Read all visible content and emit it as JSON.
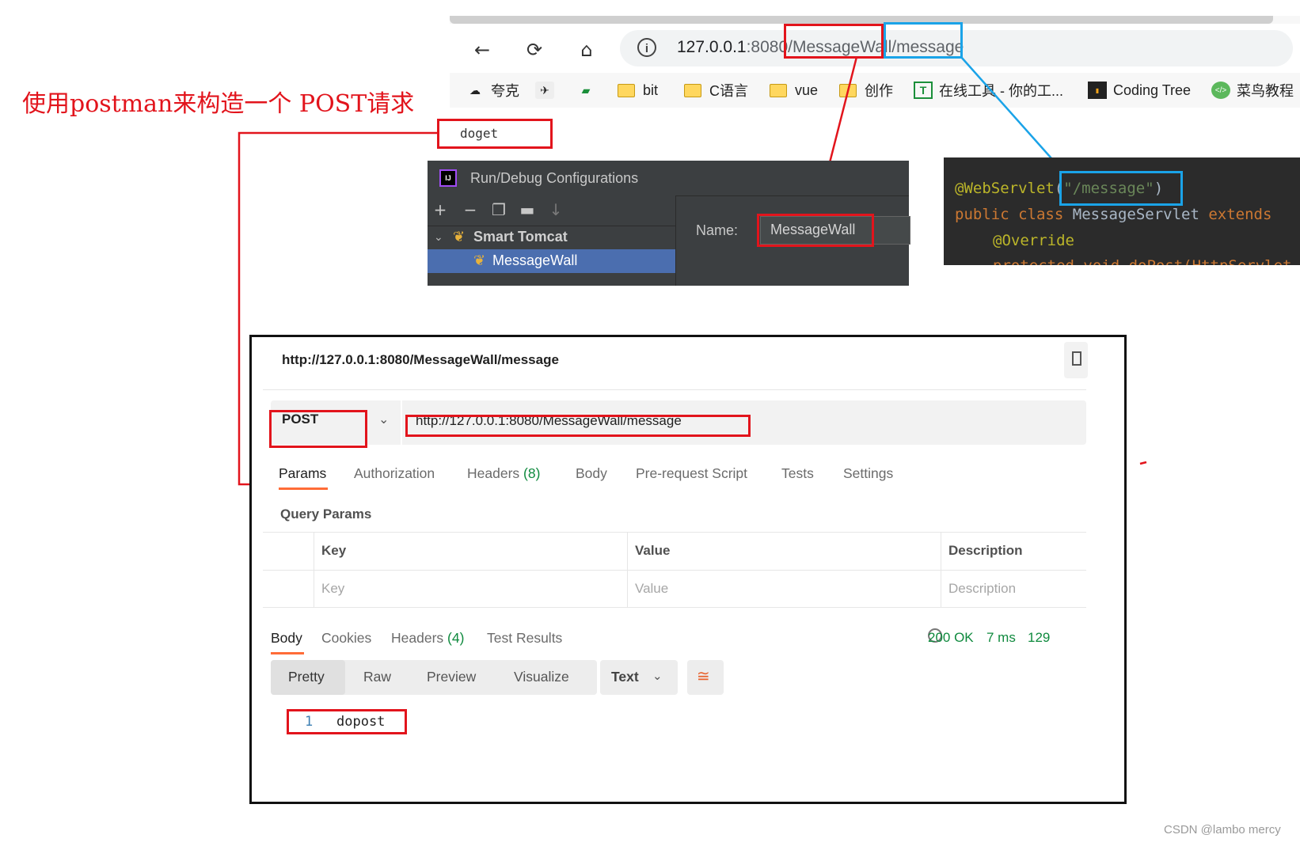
{
  "annotation": {
    "title": "使用postman来构造一个 POST请求",
    "doget_label": "doget"
  },
  "browser": {
    "url_host": "127.0.0.1",
    "url_port": ":8080",
    "url_path_context": "/MessageWall",
    "url_path_servlet": "/message",
    "bookmarks": [
      {
        "label": "夸克",
        "icon": "quark-icon"
      },
      {
        "label": "",
        "icon": "plugin-icon"
      },
      {
        "label": "",
        "icon": "map-icon"
      },
      {
        "label": "bit",
        "icon": "folder-icon"
      },
      {
        "label": "C语言",
        "icon": "folder-icon"
      },
      {
        "label": "vue",
        "icon": "folder-icon"
      },
      {
        "label": "创作",
        "icon": "folder-icon"
      },
      {
        "label": "在线工具 - 你的工...",
        "icon": "tool-icon"
      },
      {
        "label": "Coding Tree",
        "icon": "coding-tree-icon"
      },
      {
        "label": "菜鸟教程",
        "icon": "runoob-icon"
      }
    ]
  },
  "ide": {
    "window_title": "Run/Debug Configurations",
    "tree_parent": "Smart Tomcat",
    "tree_child": "MessageWall",
    "name_label": "Name:",
    "name_value": "MessageWall"
  },
  "code": {
    "line1_annotation": "@WebServlet",
    "line1_paren_open": "(",
    "line1_string": "\"/message\"",
    "line1_paren_close": ")",
    "line2_public": "public",
    "line2_class": "class",
    "line2_name": "MessageServlet",
    "line2_extends": "extends",
    "line3": "@Override",
    "line4": "protected void doPost(HttpServlet"
  },
  "postman": {
    "tab_title": "http://127.0.0.1:8080/MessageWall/message",
    "method": "POST",
    "request_url": "http://127.0.0.1:8080/MessageWall/message",
    "request_tabs": {
      "params": "Params",
      "authorization": "Authorization",
      "headers": "Headers",
      "headers_count": "(8)",
      "body": "Body",
      "prerequest": "Pre-request Script",
      "tests": "Tests",
      "settings": "Settings"
    },
    "query_params_title": "Query Params",
    "table": {
      "headers": [
        "Key",
        "Value",
        "Description"
      ],
      "placeholders": [
        "Key",
        "Value",
        "Description"
      ]
    },
    "response_tabs": {
      "body": "Body",
      "cookies": "Cookies",
      "headers": "Headers",
      "headers_count": "(4)",
      "test_results": "Test Results"
    },
    "status": {
      "code": "200 OK",
      "time": "7 ms",
      "size": "129"
    },
    "view_modes": [
      "Pretty",
      "Raw",
      "Preview",
      "Visualize"
    ],
    "format": "Text",
    "response_lines": [
      {
        "no": "1",
        "text": "dopost"
      }
    ]
  },
  "watermark": "CSDN @lambo mercy",
  "colors": {
    "annotation_red": "#e2141c",
    "annotation_blue": "#1aa3e8",
    "postman_orange": "#ff6c37",
    "status_green": "#0f8a3e"
  }
}
